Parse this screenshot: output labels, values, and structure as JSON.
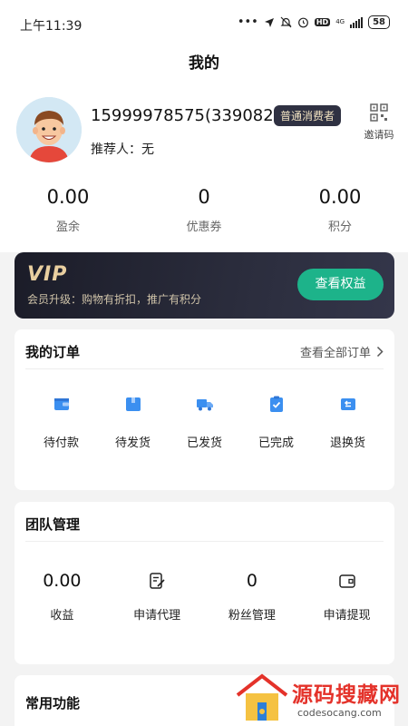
{
  "status_bar": {
    "time": "上午11:39",
    "dots": "•••",
    "hd": "HD",
    "network": "4G",
    "battery": "58"
  },
  "header": {
    "title": "我的"
  },
  "profile": {
    "phone": "15999978575(3390827)",
    "member_level": "普通消费者",
    "invite_label": "邀请码",
    "referrer": "推荐人：无"
  },
  "stats": [
    {
      "value": "0.00",
      "label": "盈余"
    },
    {
      "value": "0",
      "label": "优惠券"
    },
    {
      "value": "0.00",
      "label": "积分"
    }
  ],
  "vip": {
    "logo": "VIP",
    "description": "会员升级：购物有折扣，推广有积分",
    "button": "查看权益"
  },
  "orders": {
    "title": "我的订单",
    "view_all": "查看全部订单",
    "items": [
      {
        "label": "待付款",
        "icon": "wallet-icon"
      },
      {
        "label": "待发货",
        "icon": "package-icon"
      },
      {
        "label": "已发货",
        "icon": "truck-icon"
      },
      {
        "label": "已完成",
        "icon": "check-clipboard-icon"
      },
      {
        "label": "退换货",
        "icon": "return-icon"
      }
    ]
  },
  "team": {
    "title": "团队管理",
    "items": [
      {
        "value": "0.00",
        "label": "收益"
      },
      {
        "icon": "edit-document-icon",
        "label": "申请代理"
      },
      {
        "value": "0",
        "label": "粉丝管理"
      },
      {
        "icon": "wallet-outline-icon",
        "label": "申请提现"
      }
    ]
  },
  "common": {
    "title": "常用功能"
  },
  "watermark": {
    "title": "源码搜藏网",
    "url": "codesocang.com"
  },
  "colors": {
    "accent": "#1db38a",
    "vip_bg": "#1b1c28",
    "icon_blue": "#3b8ff0"
  }
}
